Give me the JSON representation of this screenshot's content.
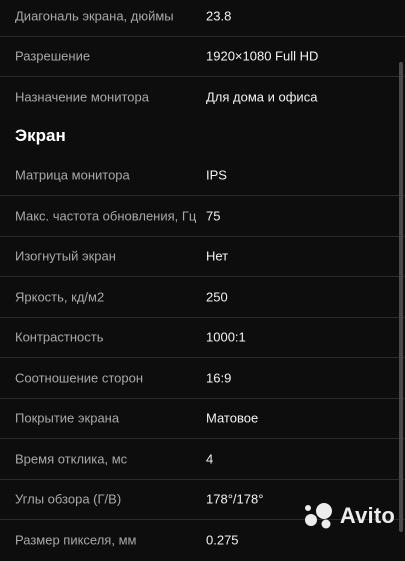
{
  "rows_top": [
    {
      "label": "Диагональ экрана, дюймы",
      "value": "23.8"
    },
    {
      "label": "Разрешение",
      "value": "1920×1080 Full HD"
    },
    {
      "label": "Назначение монитора",
      "value": "Для дома и офиса"
    }
  ],
  "section": {
    "title": "Экран"
  },
  "rows_screen": [
    {
      "label": "Матрица монитора",
      "value": "IPS"
    },
    {
      "label": "Макс. частота обновления, Гц",
      "value": "75"
    },
    {
      "label": "Изогнутый экран",
      "value": "Нет"
    },
    {
      "label": "Яркость, кд/м2",
      "value": "250"
    },
    {
      "label": "Контрастность",
      "value": "1000:1"
    },
    {
      "label": "Соотношение сторон",
      "value": "16:9"
    },
    {
      "label": "Покрытие экрана",
      "value": "Матовое"
    },
    {
      "label": "Время отклика, мс",
      "value": "4"
    },
    {
      "label": "Углы обзора (Г/В)",
      "value": "178°/178°"
    },
    {
      "label": "Размер пикселя, мм",
      "value": "0.275"
    }
  ],
  "watermark": {
    "text": "Avito",
    "icon": "avito-logo-icon"
  }
}
